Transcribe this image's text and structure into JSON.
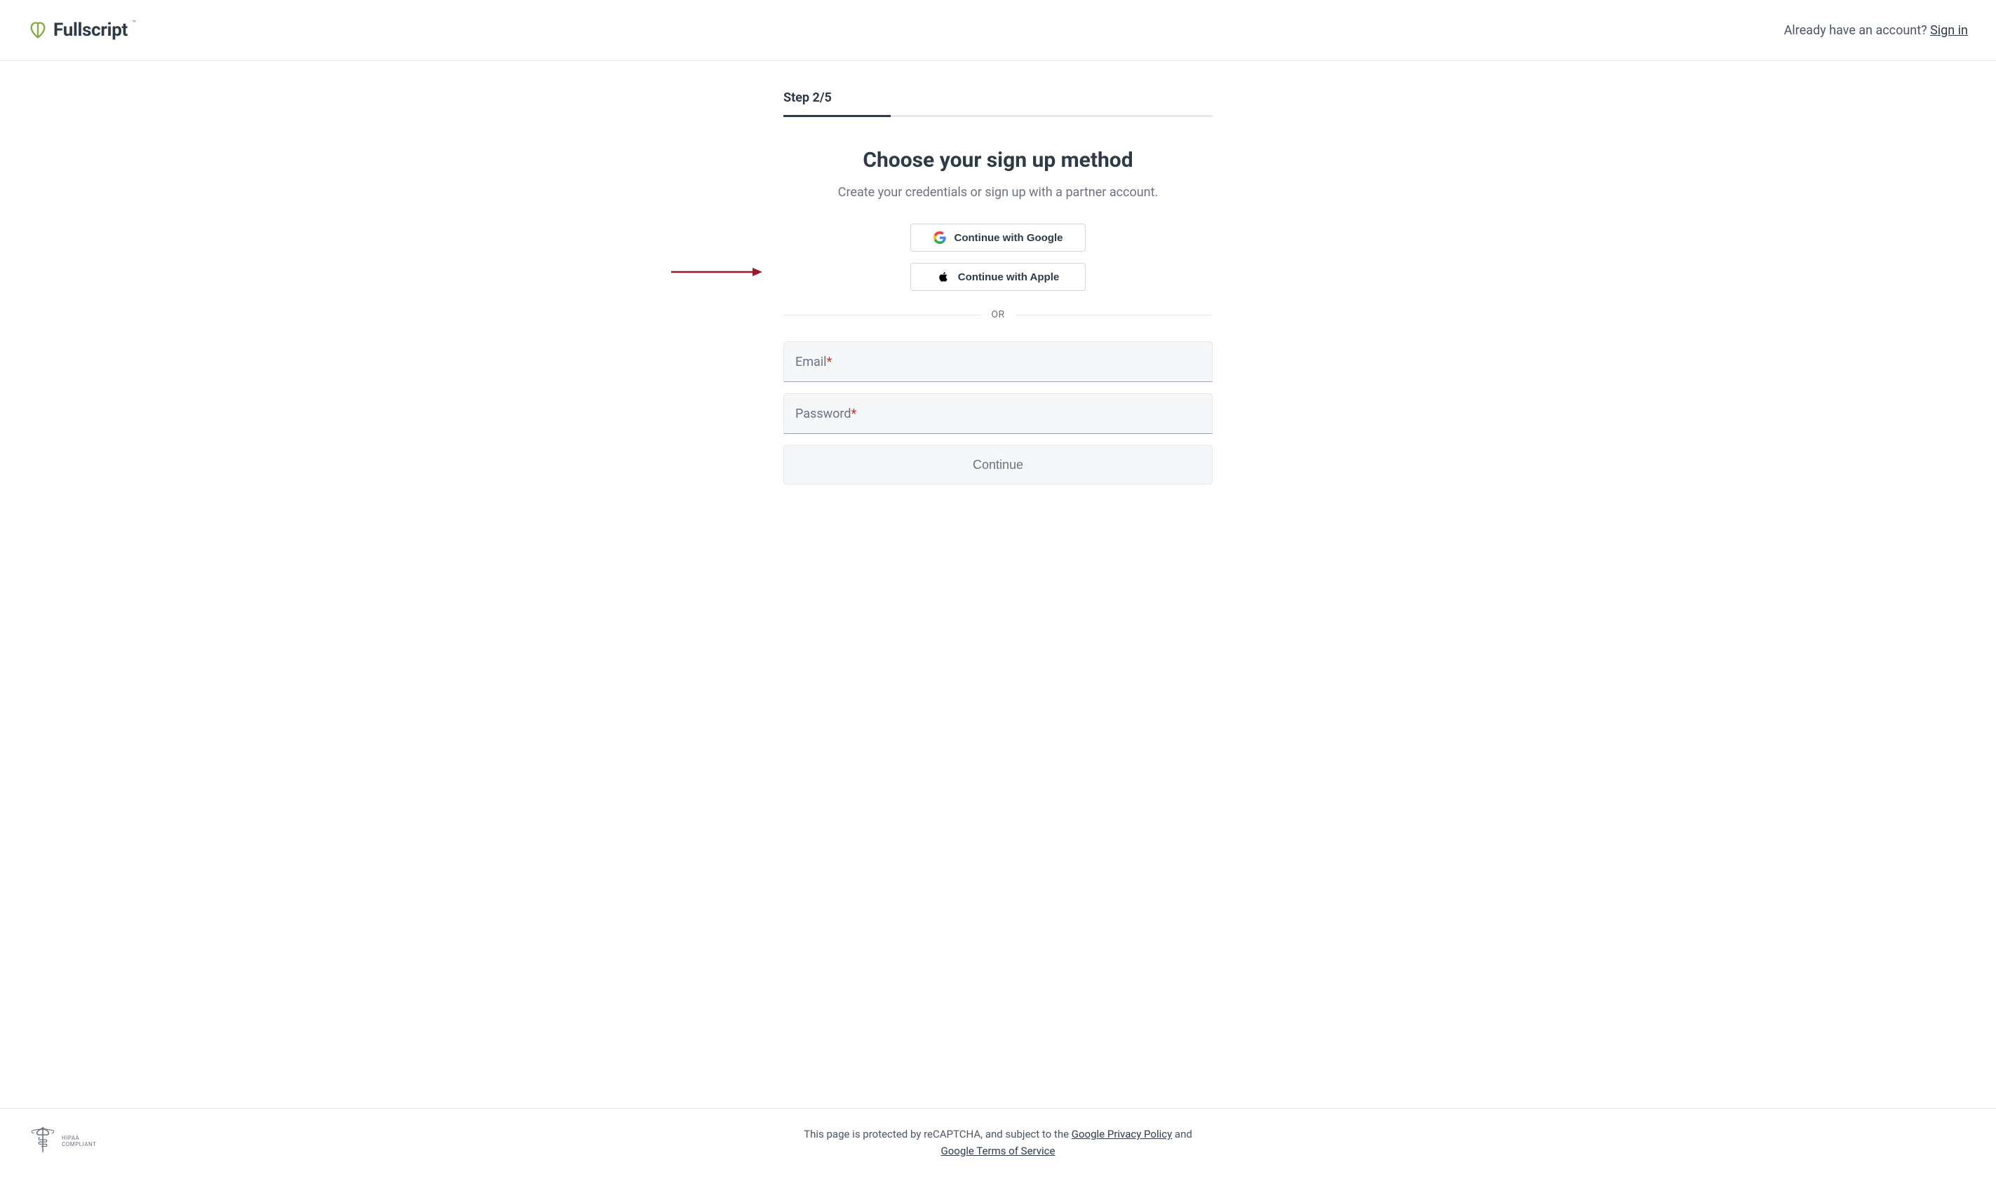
{
  "header": {
    "brand_name": "Fullscript",
    "account_prompt": "Already have an account? ",
    "signin_label": "Sign in"
  },
  "progress": {
    "step_label": "Step 2/5",
    "current": 2,
    "total": 5,
    "fill_percent": "25%"
  },
  "main": {
    "heading": "Choose your sign up method",
    "subheading": "Create your credentials or sign up with a partner account.",
    "google_label": "Continue with Google",
    "apple_label": "Continue with Apple",
    "divider_text": "OR",
    "email_label": "Email",
    "password_label": "Password",
    "required_marker": "*",
    "continue_label": "Continue"
  },
  "footer": {
    "hipaa_line1": "HIPAA",
    "hipaa_line2": "COMPLIANT",
    "recaptcha_prefix": "This page is protected by reCAPTCHA, and subject to the ",
    "privacy_label": "Google Privacy Policy",
    "mid_text": " and ",
    "tos_label": "Google Terms of Service"
  },
  "annotation": {
    "arrow_color": "#a31628"
  }
}
